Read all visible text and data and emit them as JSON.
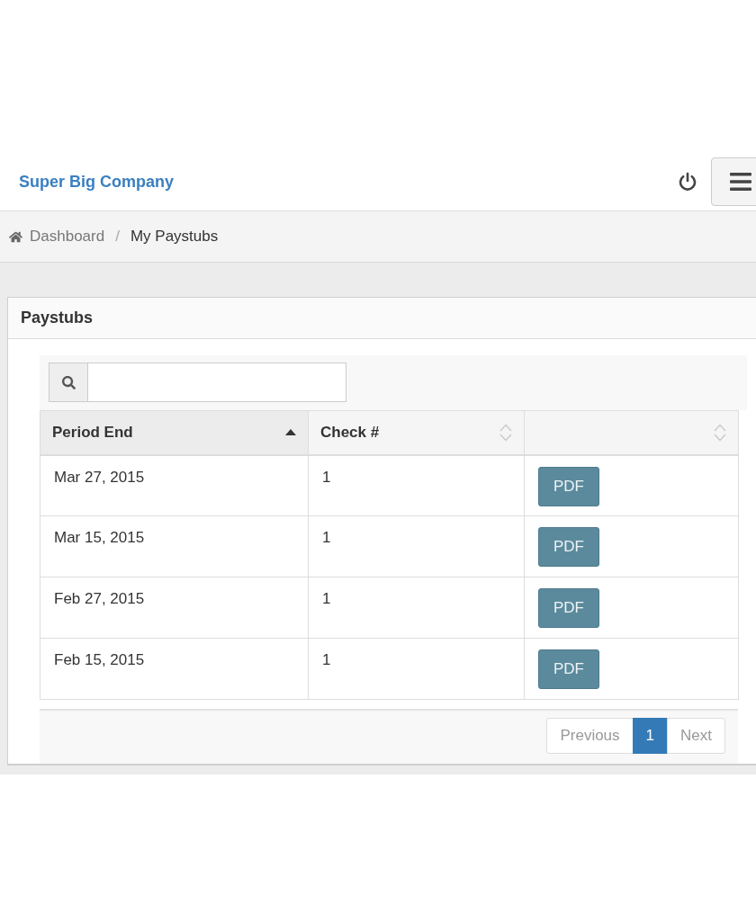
{
  "navbar": {
    "brand": "Super Big Company"
  },
  "breadcrumb": {
    "separator": "/",
    "items": [
      {
        "label": "Dashboard",
        "kind": "link"
      },
      {
        "label": "My Paystubs",
        "kind": "current"
      }
    ]
  },
  "panel": {
    "title": "Paystubs"
  },
  "table": {
    "columns": [
      {
        "label": "Period End",
        "sorted": true
      },
      {
        "label": "Check #",
        "sorted": false
      },
      {
        "sorted": false
      }
    ],
    "rows": [
      {
        "period_end": "Mar 27, 2015",
        "check": "1",
        "action": "PDF"
      },
      {
        "period_end": "Mar 15, 2015",
        "check": "1",
        "action": "PDF"
      },
      {
        "period_end": "Feb 27, 2015",
        "check": "1",
        "action": "PDF"
      },
      {
        "period_end": "Feb 15, 2015",
        "check": "1",
        "action": "PDF"
      }
    ]
  },
  "pagination": {
    "previous": {
      "label": "Previous",
      "disabled": true
    },
    "pages": [
      {
        "label": "1",
        "selected": true
      }
    ],
    "next": {
      "label": "Next",
      "disabled": true
    }
  }
}
